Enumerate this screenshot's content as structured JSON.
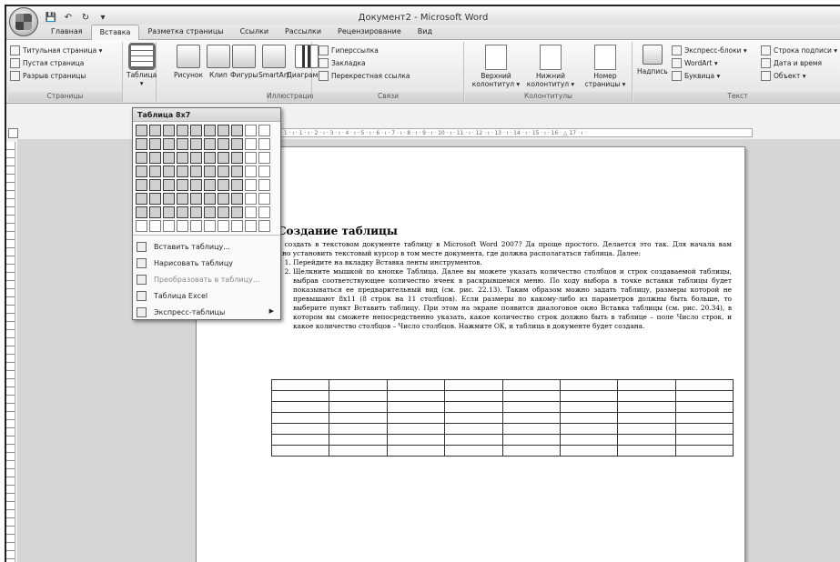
{
  "window": {
    "title": "Документ2 - Microsoft Word"
  },
  "qat": [
    "save-icon",
    "undo-icon",
    "redo-icon",
    "customize-icon"
  ],
  "tabs": [
    {
      "label": "Главная",
      "active": false
    },
    {
      "label": "Вставка",
      "active": true
    },
    {
      "label": "Разметка страницы",
      "active": false
    },
    {
      "label": "Ссылки",
      "active": false
    },
    {
      "label": "Рассылки",
      "active": false
    },
    {
      "label": "Рецензирование",
      "active": false
    },
    {
      "label": "Вид",
      "active": false
    }
  ],
  "ribbon": {
    "pages": {
      "label": "Страницы",
      "items": [
        "Титульная страница ▾",
        "Пустая страница",
        "Разрыв страницы"
      ]
    },
    "tables": {
      "button": "Таблица"
    },
    "illustrations": {
      "label": "Иллюстрации",
      "items": [
        "Рисунок",
        "Клип",
        "Фигуры",
        "SmartArt",
        "Диаграмма"
      ]
    },
    "links": {
      "label": "Связи",
      "items": [
        "Гиперссылка",
        "Закладка",
        "Перекрестная ссылка"
      ]
    },
    "header_footer": {
      "label": "Колонтитулы",
      "items": [
        "Верхний колонтитул ▾",
        "Нижний колонтитул ▾",
        "Номер страницы ▾"
      ]
    },
    "text": {
      "label": "Текст",
      "textbox": "Надпись",
      "items": [
        "Экспресс-блоки ▾",
        "WordArt ▾",
        "Буквица ▾"
      ],
      "right_items": [
        "Строка подписи ▾",
        "Дата и время",
        "Объект ▾"
      ]
    }
  },
  "ruler": {
    "text": "· 1 · ı · 1 · ı · 2 · ı · 3 · ı · 4 · ı · 5 · ı · 6 · ı · 7 · ı · 8 · ı · 9 · ı · 10 · ı · 11 · ı · 12 · ı · 13 · ı · 14 · ı · 15 · ı · 16 · △ 17 · ı ·"
  },
  "dropdown": {
    "header": "Таблица 8x7",
    "grid_cols": 10,
    "grid_rows": 8,
    "selected_cols": 8,
    "selected_rows": 7,
    "menu": [
      {
        "label": "Вставить таблицу...",
        "icon": "insert-table-icon",
        "disabled": false
      },
      {
        "label": "Нарисовать таблицу",
        "icon": "draw-table-icon",
        "disabled": false
      },
      {
        "label": "Преобразовать в таблицу...",
        "icon": "convert-table-icon",
        "disabled": true
      },
      {
        "label": "Таблица Excel",
        "icon": "excel-table-icon",
        "disabled": false
      },
      {
        "label": "Экспресс-таблицы",
        "icon": "quick-tables-icon",
        "disabled": false,
        "submenu": true
      }
    ]
  },
  "document": {
    "heading": "Создание таблицы",
    "intro": "Как создать в текстовом документе таблицу в Microsoft Word 2007? Да проще простого. Делается это так. Для начала вам нужно установить текстовый курсор в том месте документа, где должна располагаться таблица. Далее:",
    "steps": [
      "Перейдите на вкладку Вставка ленты инструментов.",
      "Щелкните мышкой по кнопке Таблица. Далее вы можете указать количество столбцов и строк создаваемой таблицы, выбрав соответствующее количество ячеек в раскрывшемся меню. По ходу выбора в точке вставки таблицы будет показываться ее предварительный вид (см. рис. 22.13). Таким образом можно задать таблицу, размеры которой не превышают 8x11 (8 строк на 11 столбцов). Если размеры по какому-либо из параметров должны быть больше, то выберите пункт Вставить таблицу. При этом на экране появится диалоговое окно Вставка таблицы (см. рис. 20.34), в котором вы сможете непосредственно указать, какое количество строк должно быть в таблице – поле Число строк, и какое количество столбцов – Число столбцов. Нажмите ОК, и таблица в документе будет создана."
    ],
    "table_rows": 7,
    "table_cols": 8
  }
}
